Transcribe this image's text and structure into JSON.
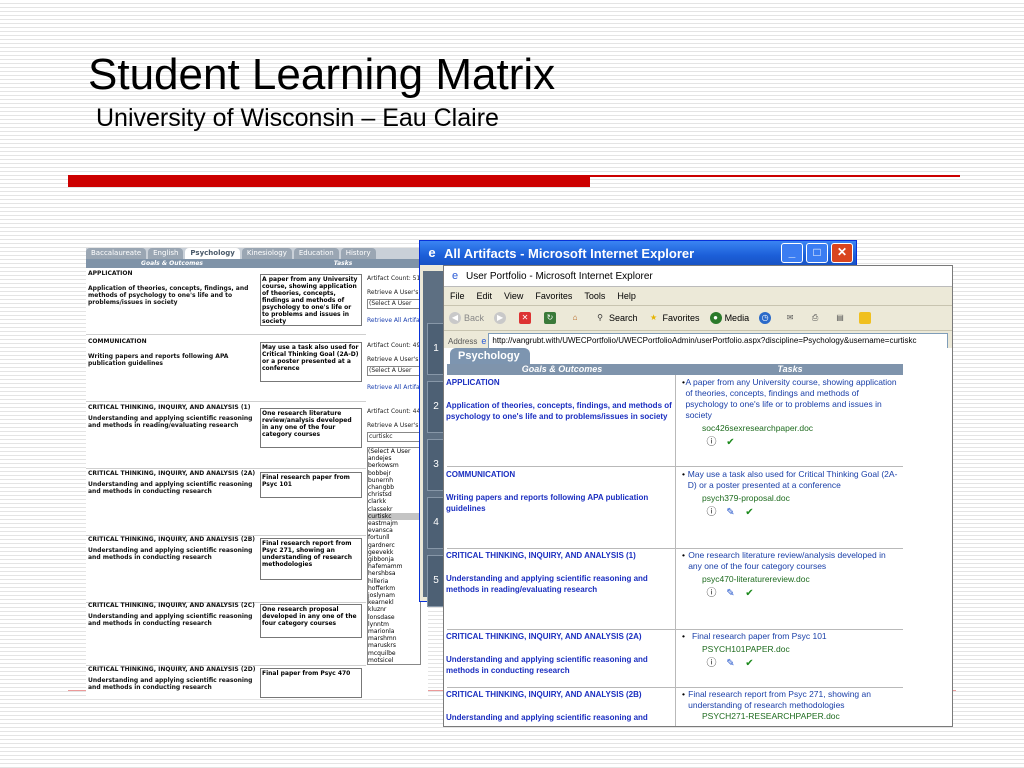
{
  "slide": {
    "title": "Student Learning Matrix",
    "subtitle": "University of Wisconsin – Eau Claire"
  },
  "back": {
    "tabs": [
      "Baccalaureate",
      "English",
      "Psychology",
      "Kinesiology",
      "Education",
      "History"
    ],
    "active_tab": "Psychology",
    "header_goals": "Goals & Outcomes",
    "header_tasks": "Tasks",
    "rows": [
      {
        "heading": "APPLICATION",
        "text": "Application of theories, concepts, findings, and methods of psychology to one's life and to problems/issues in society",
        "task": "A paper from any University course, showing application of theories, concepts, findings and methods of psychology to one's life or to problems and issues in society",
        "count": "Artifact Count: 51",
        "retrieve": "Retrieve A User's",
        "select": "(Select A User",
        "link": "Retrieve All Artifa"
      },
      {
        "heading": "COMMUNICATION",
        "text": "Writing papers and reports following APA publication guidelines",
        "task": "May use a task also used for Critical Thinking Goal (2A-D) or a poster presented at a conference",
        "count": "Artifact Count: 49",
        "retrieve": "Retrieve A User's",
        "select": "(Select A User",
        "link": "Retrieve All Artifa"
      },
      {
        "heading": "CRITICAL THINKING, INQUIRY, AND ANALYSIS (1)",
        "text": "Understanding and applying scientific reasoning and methods in reading/evaluating research",
        "task": "One research literature review/analysis developed in any one of the four category courses",
        "count": "Artifact Count: 44",
        "retrieve": "Retrieve A User's",
        "select": "curtiskc",
        "link": ""
      },
      {
        "heading": "CRITICAL THINKING, INQUIRY, AND ANALYSIS (2A)",
        "text": "Understanding and applying scientific reasoning and methods in conducting research",
        "task": "Final research paper from Psyc 101"
      },
      {
        "heading": "CRITICAL THINKING, INQUIRY, AND ANALYSIS (2B)",
        "text": "Understanding and applying scientific reasoning and methods in conducting research",
        "task": "Final research report from Psyc 271, showing an understanding of research methodologies"
      },
      {
        "heading": "CRITICAL THINKING, INQUIRY, AND ANALYSIS (2C)",
        "text": "Understanding and applying scientific reasoning and methods in conducting research",
        "task": "One research proposal developed in any one of the four category courses"
      },
      {
        "heading": "CRITICAL THINKING, INQUIRY, AND ANALYSIS (2D)",
        "text": "Understanding and applying scientific reasoning and methods in conducting research",
        "task": "Final paper from Psyc 470"
      }
    ],
    "user_list": [
      "(Select A User",
      "andejes",
      "berkowsm",
      "bobbejr",
      "bunernh",
      "changbb",
      "christsd",
      "clarkk",
      "classekr",
      "curtiskc",
      "eastmajm",
      "evansca",
      "fortunll",
      "gardnerc",
      "geevekk",
      "gibbonja",
      "hafemamm",
      "hershbsa",
      "hilleria",
      "hofferkm",
      "joslynam",
      "kearnekl",
      "kluznr",
      "lonsdase",
      "lynntm",
      "marionla",
      "marshmn",
      "maruskrs",
      "mcquilbe",
      "motsicel"
    ],
    "user_list_highlight": "classekr"
  },
  "win1": {
    "title": "All Artifacts - Microsoft Internet Explorer",
    "numbers": [
      "1",
      "2",
      "3",
      "4",
      "5"
    ]
  },
  "win2": {
    "title": "User Portfolio - Microsoft Internet Explorer",
    "menu": [
      "File",
      "Edit",
      "View",
      "Favorites",
      "Tools",
      "Help"
    ],
    "toolbar": {
      "back": "Back",
      "search": "Search",
      "favorites": "Favorites",
      "media": "Media"
    },
    "address_label": "Address",
    "address": "http://vangrubt.with/UWECPortfolio/UWECPortfolioAdmin/userPortfolio.aspx?discipline=Psychology&username=curtiskc",
    "tab": "Psychology",
    "header_goals": "Goals & Outcomes",
    "header_tasks": "Tasks",
    "rows": [
      {
        "heading": "APPLICATION",
        "text": "Application of theories, concepts, findings, and methods of psychology to one's life and to problems/issues in society",
        "task": "A paper from any University course, showing application of theories, concepts, findings and methods of psychology to one's life or to problems and issues in society",
        "file": "soc426sexresearchpaper.doc",
        "has_edit": false
      },
      {
        "heading": "COMMUNICATION",
        "text": "Writing papers and reports following APA publication guidelines",
        "task": "May use a task also used for Critical Thinking Goal (2A-D) or a poster presented at a conference",
        "file": "psych379-proposal.doc",
        "has_edit": true
      },
      {
        "heading": "CRITICAL THINKING, INQUIRY, AND ANALYSIS (1)",
        "text": "Understanding and applying scientific reasoning and methods in reading/evaluating research",
        "task": "One research literature review/analysis developed in any one of the four category courses",
        "file": "psyc470-literaturereview.doc",
        "has_edit": true
      },
      {
        "heading": "CRITICAL THINKING, INQUIRY, AND ANALYSIS (2A)",
        "text": "Understanding and applying scientific reasoning and methods in conducting research",
        "task": "Final research paper from Psyc 101",
        "file": "PSYCH101PAPER.doc",
        "has_edit": true
      },
      {
        "heading": "CRITICAL THINKING, INQUIRY, AND ANALYSIS (2B)",
        "text": "Understanding and applying scientific reasoning and",
        "task": "Final research report from Psyc 271, showing an understanding of research methodologies",
        "file": "PSYCH271-RESEARCHPAPER.doc",
        "has_edit": false
      }
    ]
  },
  "colors": {
    "accent_red": "#cc0000",
    "xp_blue": "#1c5fd8",
    "link_blue": "#1a3fa8"
  }
}
